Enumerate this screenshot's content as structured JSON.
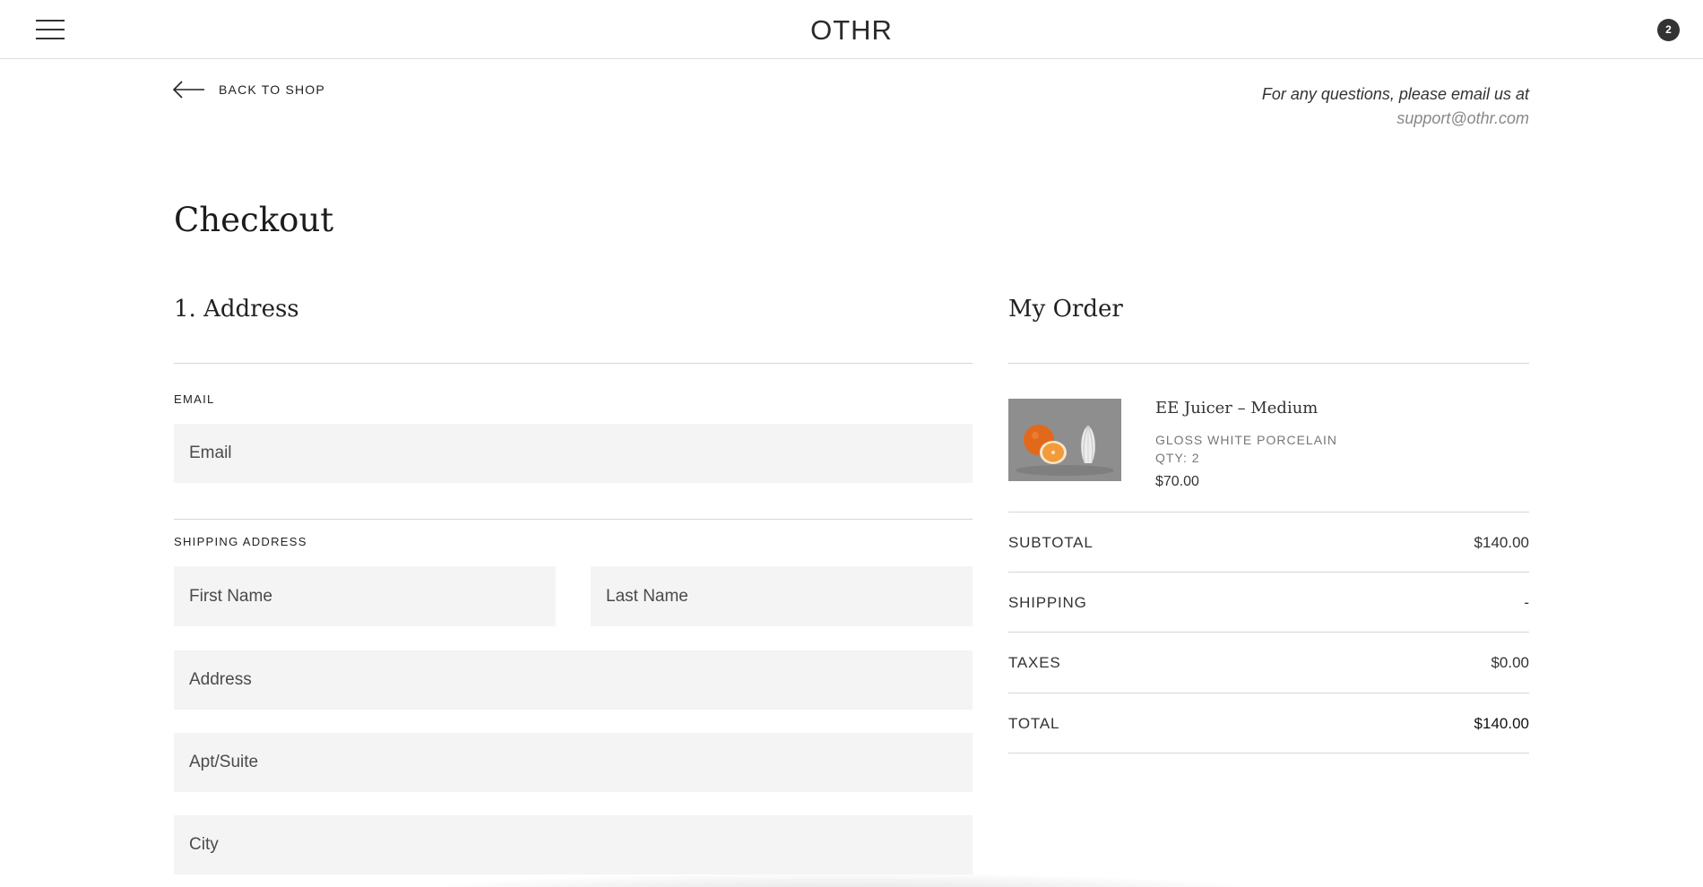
{
  "header": {
    "logo": "OTHR",
    "cart_count": "2",
    "menu_icon": "hamburger-menu-icon"
  },
  "nav": {
    "back_label": "BACK TO SHOP",
    "back_icon": "arrow-left-icon"
  },
  "support": {
    "line": "For any questions, please email us at",
    "email": "support@othr.com"
  },
  "page": {
    "title": "Checkout"
  },
  "address": {
    "title": "1. Address",
    "email_label": "EMAIL",
    "email_placeholder": "Email",
    "shipping_label": "SHIPPING ADDRESS",
    "first_name_placeholder": "First Name",
    "last_name_placeholder": "Last Name",
    "address_placeholder": "Address",
    "apt_placeholder": "Apt/Suite",
    "city_placeholder": "City"
  },
  "order": {
    "title": "My Order",
    "item": {
      "name": "EE Juicer – Medium",
      "variant": "GLOSS WHITE PORCELAIN",
      "qty": "QTY: 2",
      "price": "$70.00"
    },
    "summary": {
      "subtotal_label": "SUBTOTAL",
      "subtotal_value": "$140.00",
      "shipping_label": "SHIPPING",
      "shipping_value": "-",
      "taxes_label": "TAXES",
      "taxes_value": "$0.00",
      "total_label": "TOTAL",
      "total_value": "$140.00"
    }
  },
  "colors": {
    "input_bg": "#f4f4f4",
    "rule": "#d6d6d6",
    "badge": "#333333"
  }
}
